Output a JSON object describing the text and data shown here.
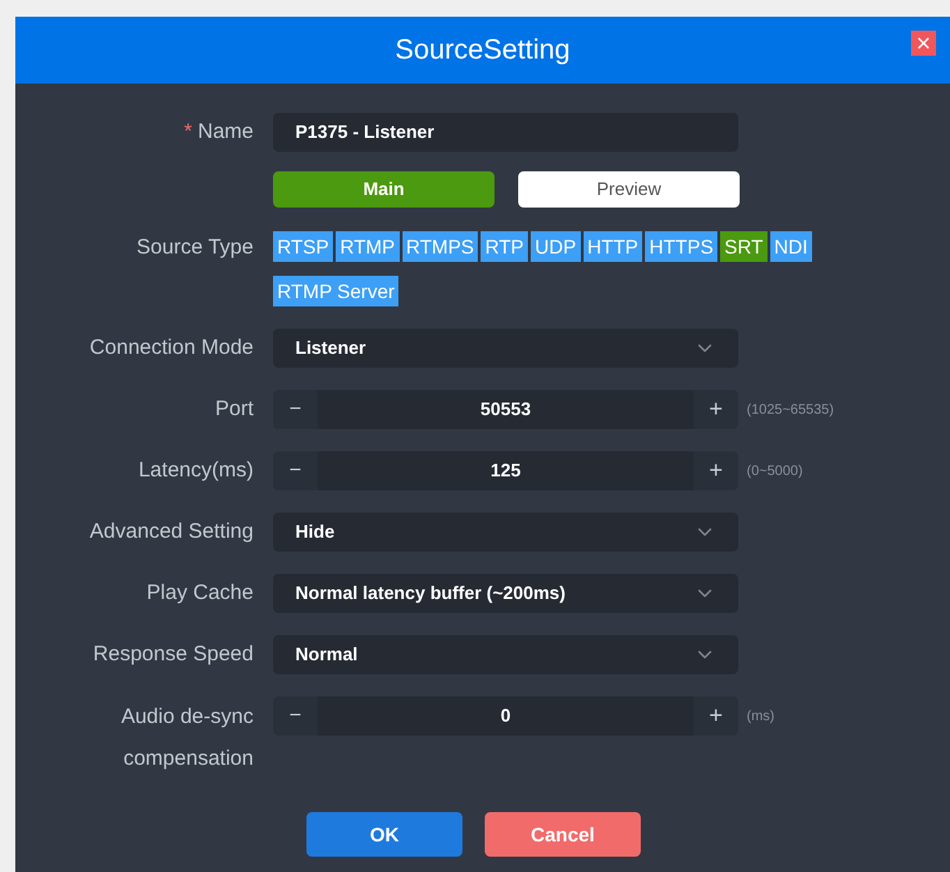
{
  "window": {
    "title": "SourceSetting",
    "close": "×"
  },
  "name_field": {
    "label": "Name",
    "required_mark": "*",
    "value": "P1375 - Listener"
  },
  "stream_tabs": [
    {
      "label": "Main",
      "selected": true
    },
    {
      "label": "Preview",
      "selected": false
    }
  ],
  "source_type": {
    "label": "Source Type",
    "options": [
      {
        "label": "RTSP",
        "selected": false
      },
      {
        "label": "RTMP",
        "selected": false
      },
      {
        "label": "RTMPS",
        "selected": false
      },
      {
        "label": "RTP",
        "selected": false
      },
      {
        "label": "UDP",
        "selected": false
      },
      {
        "label": "HTTP",
        "selected": false
      },
      {
        "label": "HTTPS",
        "selected": false
      },
      {
        "label": "SRT",
        "selected": true
      },
      {
        "label": "NDI",
        "selected": false
      },
      {
        "label": "RTMP Server",
        "selected": false
      }
    ]
  },
  "fields": [
    {
      "kind": "select",
      "label": "Connection Mode",
      "value": "Listener"
    },
    {
      "kind": "stepper",
      "label": "Port",
      "value": "50553",
      "minus": "−",
      "plus": "+",
      "hint": "(1025~65535)"
    },
    {
      "kind": "stepper",
      "label": "Latency(ms)",
      "value": "125",
      "minus": "−",
      "plus": "+",
      "hint": "(0~5000)"
    },
    {
      "kind": "select",
      "label": "Advanced Setting",
      "value": "Hide"
    },
    {
      "kind": "select",
      "label": "Play Cache",
      "value": "Normal latency buffer (~200ms)"
    },
    {
      "kind": "select",
      "label": "Response Speed",
      "value": "Normal"
    },
    {
      "kind": "stepper",
      "label": "Audio de-sync compensation",
      "value": "0",
      "minus": "−",
      "plus": "+",
      "hint": "(ms)"
    }
  ],
  "buttons": [
    {
      "kind": "primary",
      "label": "OK"
    },
    {
      "kind": "danger",
      "label": "Cancel"
    }
  ]
}
